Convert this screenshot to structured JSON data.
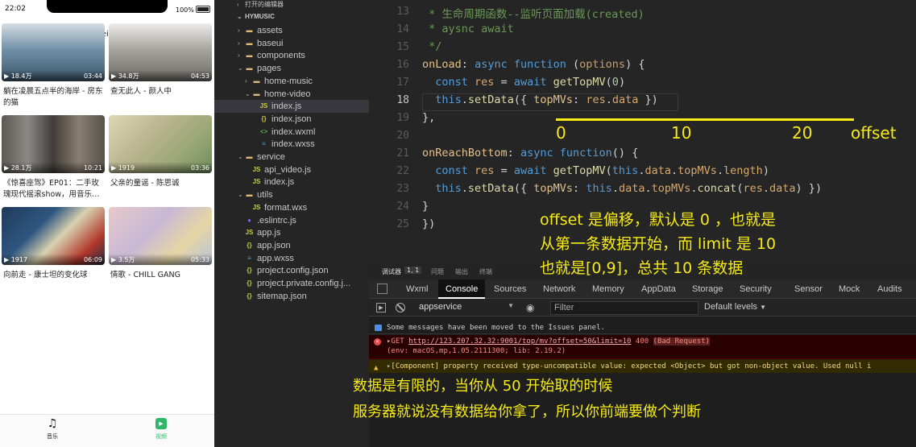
{
  "phone": {
    "status": {
      "time": "22:02",
      "battery": "100%"
    },
    "nav": {
      "title": "Weixin"
    },
    "cards": [
      {
        "views": "18.4万",
        "duration": "03:44",
        "title": "躺在凌晨五点半的海岸 - 房东的猫",
        "color": "#4a6d85"
      },
      {
        "views": "34.8万",
        "duration": "04:53",
        "title": "查无此人 - 颜人中",
        "color": "#8a8782"
      },
      {
        "views": "28.1万",
        "duration": "10:21",
        "title": "《惊喜座驾》EP01：二手玫瑰现代摇滚show，用音乐…",
        "color": "#6e6a66"
      },
      {
        "views": "1919",
        "duration": "03:36",
        "title": "父亲的童谣 - 陈思诚",
        "color": "#b4b18c"
      },
      {
        "views": "1917",
        "duration": "06:09",
        "title": "向前走 - 康士坦的变化球",
        "color": "#2c4a66"
      },
      {
        "views": "3.5万",
        "duration": "05:33",
        "title": "情歌 - CHILL GANG",
        "color": "#c9b8c9"
      }
    ],
    "tabs": [
      {
        "label": "音乐",
        "icon": "music-note-icon"
      },
      {
        "label": "视频",
        "icon": "video-play-icon"
      }
    ],
    "accent": "#2fb768"
  },
  "explorer": {
    "open_editors": "打开的编辑器",
    "project": "HYMUSIC",
    "items": [
      {
        "name": "assets",
        "type": "folder"
      },
      {
        "name": "baseui",
        "type": "folder"
      },
      {
        "name": "components",
        "type": "folder"
      },
      {
        "name": "pages",
        "type": "folder-open"
      },
      {
        "name": "home-music",
        "type": "folder"
      },
      {
        "name": "home-video",
        "type": "folder-open"
      },
      {
        "name": "index.js",
        "type": "js",
        "selected": true
      },
      {
        "name": "index.json",
        "type": "json"
      },
      {
        "name": "index.wxml",
        "type": "wxml"
      },
      {
        "name": "index.wxss",
        "type": "wxss"
      },
      {
        "name": "service",
        "type": "folder-open"
      },
      {
        "name": "api_video.js",
        "type": "js"
      },
      {
        "name": "index.js",
        "type": "js"
      },
      {
        "name": "utils",
        "type": "folder-open"
      },
      {
        "name": "format.wxs",
        "type": "wxs"
      },
      {
        "name": ".eslintrc.js",
        "type": "eslint"
      },
      {
        "name": "app.js",
        "type": "js"
      },
      {
        "name": "app.json",
        "type": "json"
      },
      {
        "name": "app.wxss",
        "type": "wxss"
      },
      {
        "name": "project.config.json",
        "type": "json"
      },
      {
        "name": "project.private.config.j...",
        "type": "json"
      },
      {
        "name": "sitemap.json",
        "type": "json"
      }
    ]
  },
  "editor": {
    "lines": [
      {
        "no": "13",
        "text": " * 生命周期函数--监听页面加载(created)"
      },
      {
        "no": "14",
        "text": " * aysnc await"
      },
      {
        "no": "15",
        "text": " */"
      },
      {
        "no": "16",
        "text": "onLoad: async function (options) {"
      },
      {
        "no": "17",
        "text": "  const res = await getTopMV(0)"
      },
      {
        "no": "18",
        "text": "  this.setData({ topMVs: res.data })"
      },
      {
        "no": "19",
        "text": "},"
      },
      {
        "no": "20",
        "text": ""
      },
      {
        "no": "21",
        "text": "onReachBottom: async function() {"
      },
      {
        "no": "22",
        "text": "  const res = await getTopMV(this.data.topMVs.length)"
      },
      {
        "no": "23",
        "text": "  this.setData({ topMVs: this.data.topMVs.concat(res.data) })"
      },
      {
        "no": "24",
        "text": "}"
      },
      {
        "no": "25",
        "text": "})"
      }
    ],
    "current_line": "18"
  },
  "devtools": {
    "top_tabs": [
      "调试器",
      "1, 1",
      "问题",
      "输出",
      "终端"
    ],
    "tabs": [
      "Wxml",
      "Console",
      "Sources",
      "Network",
      "Memory",
      "AppData",
      "Storage",
      "Security",
      "Sensor",
      "Mock",
      "Audits"
    ],
    "active_tab": "Console",
    "context": "appservice",
    "filter_placeholder": "Filter",
    "levels": "Default levels",
    "messages": {
      "info": "Some messages have been moved to the Issues panel.",
      "error_method": "GET ",
      "error_url": "http://123.207.32.32:9001/top/mv?offset=50&limit=10",
      "error_status": " 400 ",
      "error_status_text": "(Bad Request)",
      "error_env": "(env: macOS,mp,1.05.2111300; lib: 2.19.2)",
      "warning": "[Component] property received type-uncompatible value: expected <Object> but got non-object value. Used null i"
    }
  },
  "annotations": {
    "axis_labels": [
      "0",
      "10",
      "20"
    ],
    "axis_word": "offset",
    "note1": [
      "offset 是偏移，默认是 0 ，也就是",
      "从第一条数据开始，而 limit 是 10",
      "也就是[0,9]，总共 10 条数据"
    ],
    "note2": [
      "数据是有限的，当你从 50 开始取的时候",
      "服务器就说没有数据给你拿了，所以你前端要做个判断"
    ],
    "color": "#f6eb16"
  }
}
